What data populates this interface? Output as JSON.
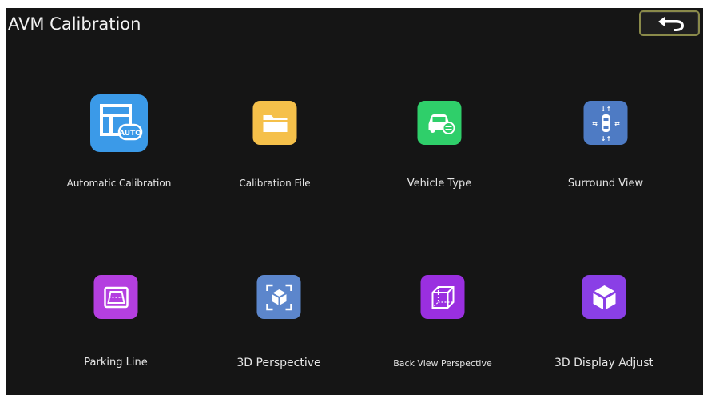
{
  "header": {
    "title": "AVM Calibration",
    "back_icon": "back-arrow-icon"
  },
  "tiles": [
    {
      "label": "Automatic Calibration",
      "icon": "auto-calibration-icon",
      "icon_text": "AUTO",
      "color": "#3b9ae8"
    },
    {
      "label": "Calibration File",
      "icon": "folder-icon",
      "color": "#f5c04a"
    },
    {
      "label": "Vehicle Type",
      "icon": "car-icon",
      "color": "#2fcf6a"
    },
    {
      "label": "Surround View",
      "icon": "surround-view-icon",
      "color": "#4e7bc4"
    },
    {
      "label": "Parking Line",
      "icon": "parking-line-icon",
      "color": "#b43fe0"
    },
    {
      "label": "3D Perspective",
      "icon": "3d-perspective-icon",
      "color": "#5c86cc"
    },
    {
      "label": "Back View Perspective",
      "icon": "back-view-cube-icon",
      "color": "#9a2fe0"
    },
    {
      "label": "3D Display Adjust",
      "icon": "3d-cube-icon",
      "color": "#8a3fe6"
    }
  ]
}
